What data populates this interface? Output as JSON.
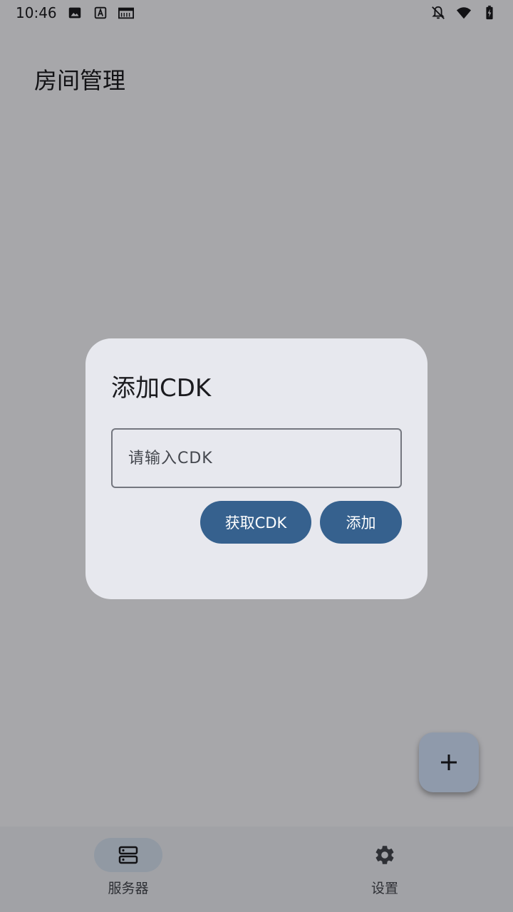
{
  "status_bar": {
    "time": "10:46",
    "icons": [
      "image-icon",
      "a-icon",
      "sim-icon",
      "mute-bell-icon",
      "wifi-icon",
      "battery-charging-icon"
    ]
  },
  "page": {
    "title": "房间管理"
  },
  "fab": {
    "icon": "plus-icon"
  },
  "bottom_nav": {
    "items": [
      {
        "label": "服务器",
        "icon": "server-icon",
        "active": true
      },
      {
        "label": "设置",
        "icon": "gear-icon",
        "active": false
      }
    ]
  },
  "dialog": {
    "title": "添加CDK",
    "input": {
      "placeholder": "请输入CDK",
      "value": ""
    },
    "get_button_label": "获取CDK",
    "add_button_label": "添加"
  },
  "colors": {
    "primary": "#36618e",
    "dialog_bg": "#e7e8ee",
    "fab_bg": "#d3e3fd"
  }
}
